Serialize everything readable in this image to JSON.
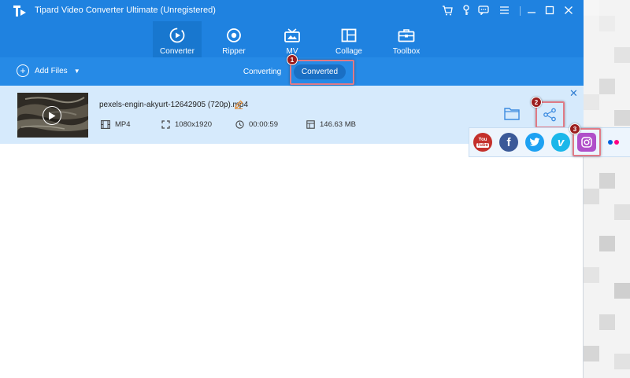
{
  "window": {
    "title": "Tipard Video Converter Ultimate (Unregistered)"
  },
  "nav": {
    "tabs": [
      {
        "label": "Converter",
        "icon": "converter-icon",
        "active": true
      },
      {
        "label": "Ripper",
        "icon": "ripper-icon",
        "active": false
      },
      {
        "label": "MV",
        "icon": "mv-icon",
        "active": false
      },
      {
        "label": "Collage",
        "icon": "collage-icon",
        "active": false
      },
      {
        "label": "Toolbox",
        "icon": "toolbox-icon",
        "active": false
      }
    ]
  },
  "toolbar": {
    "add_files_label": "Add Files",
    "tabs": [
      {
        "label": "Converting",
        "active": false
      },
      {
        "label": "Converted",
        "active": true
      }
    ]
  },
  "file": {
    "name": "pexels-engin-akyurt-12642905 (720p).mp4",
    "format": "MP4",
    "resolution": "1080x1920",
    "duration": "00:00:59",
    "size": "146.63 MB"
  },
  "share": {
    "platforms": [
      "YouTube",
      "Facebook",
      "Twitter",
      "Vimeo",
      "Instagram",
      "Flickr"
    ],
    "youtube_text_1": "You",
    "youtube_text_2": "Tube",
    "facebook_glyph": "f",
    "vimeo_glyph": "v"
  },
  "annotations": {
    "step1": "1",
    "step2": "2",
    "step3": "3"
  },
  "colors": {
    "brand_blue": "#1f82e0",
    "row_highlight": "#d6eafc",
    "callout": "#e07a86",
    "badge": "#9c1e1e"
  }
}
